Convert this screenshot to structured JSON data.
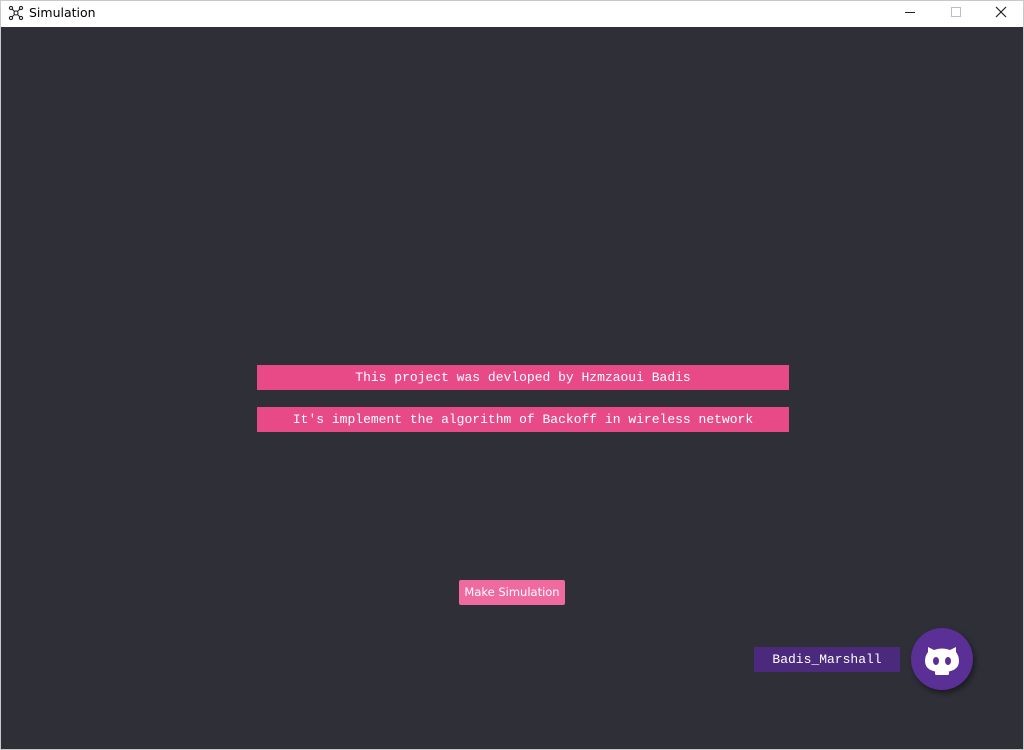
{
  "window": {
    "title": "Simulation",
    "app_icon": "network-icon",
    "controls": {
      "minimize_icon": "minimize-icon",
      "maximize_icon": "maximize-icon",
      "close_icon": "close-icon"
    }
  },
  "main": {
    "background_color": "#2f2f38",
    "banners": [
      "This project was devloped by Hzmzaoui Badis",
      "It's implement the algorithm of Backoff in wireless network"
    ],
    "banner_color": "#e84a87",
    "action_button": {
      "label": "Make Simulation",
      "color": "#ef6b9f"
    },
    "user": {
      "handle": "Badis_Marshall",
      "tag_color": "#4b2a7e",
      "avatar_icon": "github-octocat-icon",
      "avatar_color": "#5a2f96"
    }
  }
}
